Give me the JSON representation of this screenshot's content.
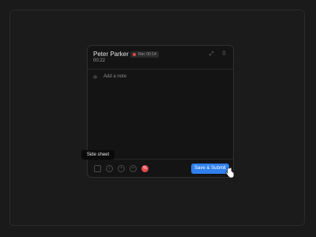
{
  "card": {
    "user_name": "Peter Parker",
    "recording_label": "Rec 00:14",
    "timer": "00:22",
    "note_placeholder": "Add a note",
    "submit_label": "Save & Submit"
  },
  "tooltip": {
    "text": "Side sheet"
  },
  "icons": {
    "collapse": "collapse-icon",
    "menu": "grid-menu-icon",
    "sidebar": "side-sheet-icon",
    "mic": "mic-icon",
    "record": "record-icon",
    "tag": "tag-icon",
    "stop": "stop-icon"
  },
  "colors": {
    "background": "#1a1a1a",
    "card": "#141414",
    "accent": "#2f80ed",
    "record": "#e5484d"
  }
}
